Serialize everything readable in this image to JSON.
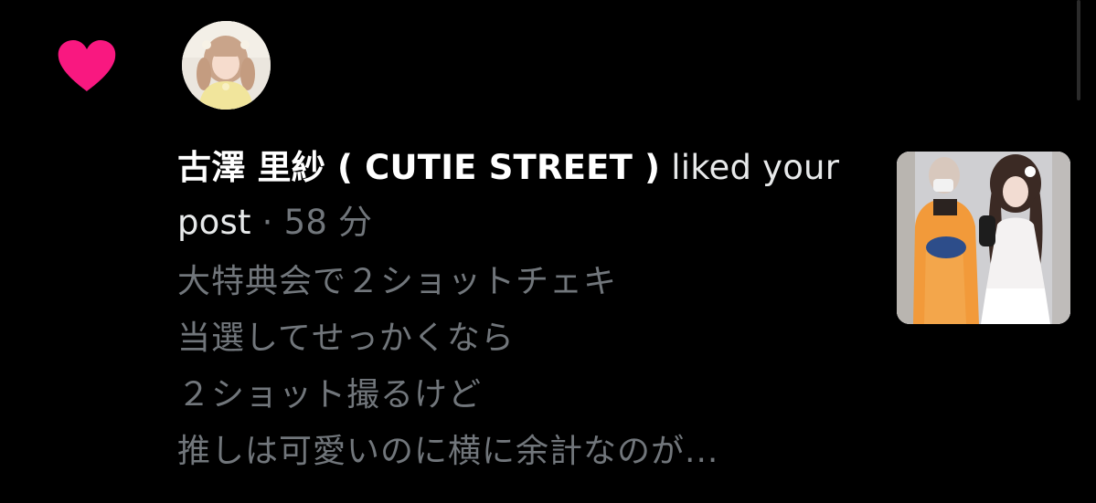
{
  "notification": {
    "type": "like",
    "icon": "heart-icon",
    "user_name": "古澤 里紗 ( CUTIE STREET )",
    "action_text": " liked your post",
    "separator": " · ",
    "time": "58 分",
    "post_preview": [
      "大特典会で２ショットチェキ",
      "当選してせっかくなら",
      "２ショット撮るけど",
      "推しは可愛いのに横に余計なのが..."
    ]
  },
  "colors": {
    "background": "#000000",
    "heart": "#f91880",
    "primary_text": "#e7e9ea",
    "secondary_text": "#71767b"
  }
}
